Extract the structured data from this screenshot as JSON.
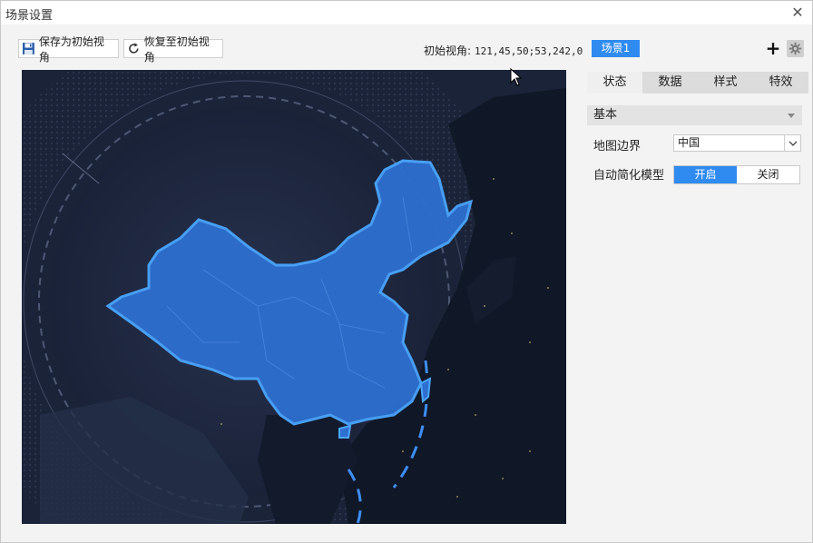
{
  "window": {
    "title": "场景设置",
    "close_label": "✕"
  },
  "toolbar": {
    "save_label": "保存为初始视角",
    "restore_label": "恢复至初始视角",
    "view_label": "初始视角:",
    "view_value": "121,45,50;53,242,0",
    "scene_tab": "场景1",
    "add_label": "+"
  },
  "panel": {
    "tabs": [
      {
        "label": "状态",
        "active": true
      },
      {
        "label": "数据",
        "active": false
      },
      {
        "label": "样式",
        "active": false
      },
      {
        "label": "特效",
        "active": false
      }
    ],
    "group_title": "基本",
    "map_border_label": "地图边界",
    "map_border_value": "中国",
    "auto_simplify_label": "自动简化模型",
    "toggle_on": "开启",
    "toggle_off": "关闭",
    "toggle_selected": "on"
  },
  "colors": {
    "accent": "#2f8bf0",
    "map_bg": "#1a2238",
    "china_fill": "#2e6fd0",
    "china_border": "#4aa6ff"
  }
}
